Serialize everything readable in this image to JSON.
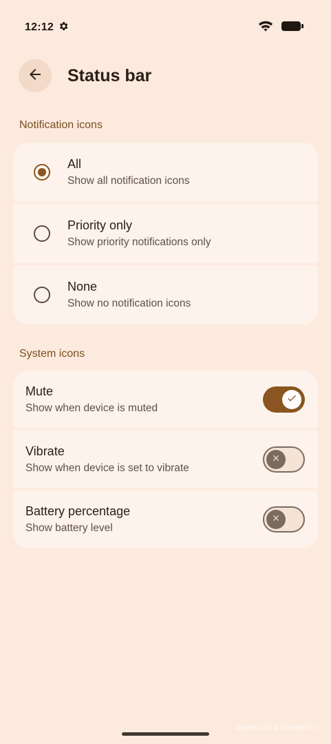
{
  "status_bar": {
    "time": "12:12"
  },
  "header": {
    "title": "Status bar"
  },
  "notification_section": {
    "label": "Notification icons",
    "options": [
      {
        "title": "All",
        "subtitle": "Show all notification icons",
        "selected": true
      },
      {
        "title": "Priority only",
        "subtitle": "Show priority notifications only",
        "selected": false
      },
      {
        "title": "None",
        "subtitle": "Show no notification icons",
        "selected": false
      }
    ]
  },
  "system_section": {
    "label": "System icons",
    "toggles": [
      {
        "title": "Mute",
        "subtitle": "Show when device is muted",
        "on": true
      },
      {
        "title": "Vibrate",
        "subtitle": "Show when device is set to vibrate",
        "on": false
      },
      {
        "title": "Battery percentage",
        "subtitle": "Show battery level",
        "on": false
      }
    ]
  },
  "watermark": "ANDROID AUTHORITY",
  "colors": {
    "background": "#fdeade",
    "card": "#fdf3ec",
    "accent": "#8a5520",
    "section_label": "#7a4e1e"
  }
}
